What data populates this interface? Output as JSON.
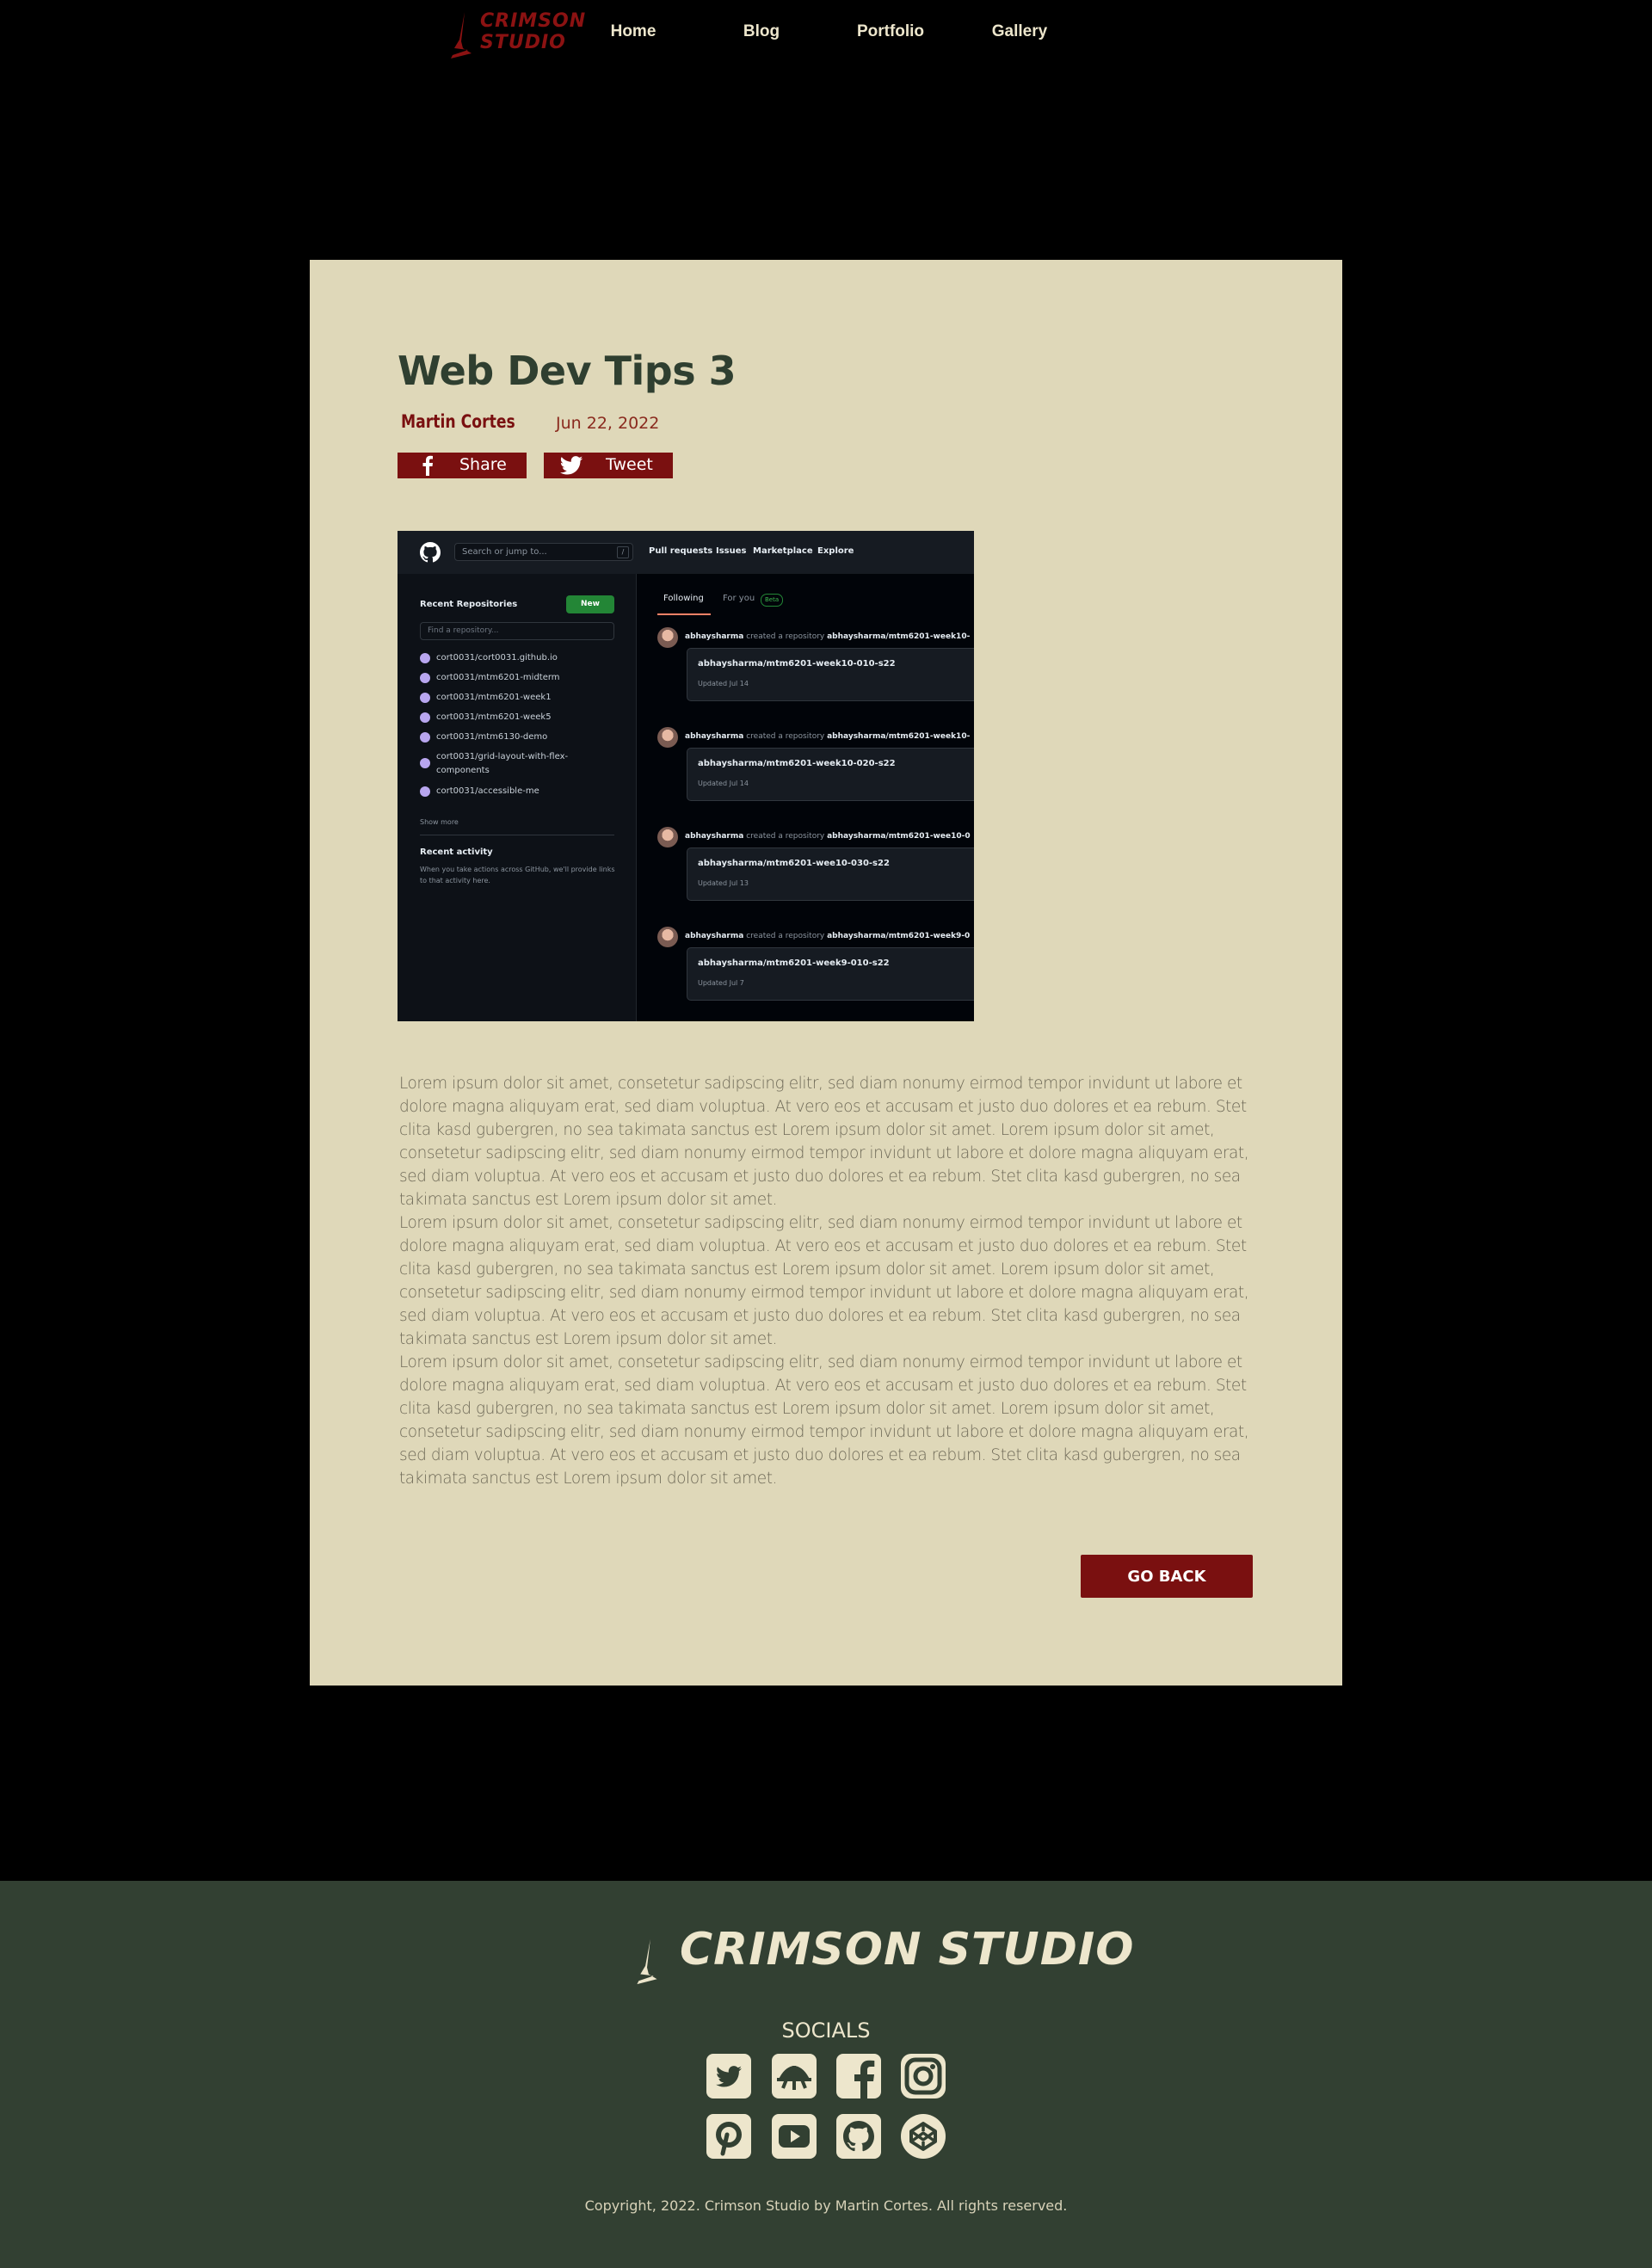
{
  "brand": {
    "header_logo_lines": [
      "CRIMSON",
      "STUDIO"
    ],
    "footer_logo_text": "CRIMSON STUDIO"
  },
  "nav": {
    "items": [
      {
        "label": "Home"
      },
      {
        "label": "Blog"
      },
      {
        "label": "Portfolio"
      },
      {
        "label": "Gallery"
      }
    ]
  },
  "post": {
    "title": "Web Dev Tips 3",
    "author": "Martin Cortes",
    "date": "Jun 22, 2022",
    "share_label": "Share",
    "tweet_label": "Tweet",
    "paragraphs": [
      "Lorem ipsum dolor sit amet, consetetur sadipscing elitr, sed diam nonumy eirmod tempor invidunt ut labore et dolore magna aliquyam erat, sed diam voluptua. At vero eos et accusam et justo duo dolores et ea rebum. Stet clita kasd gubergren, no sea takimata sanctus est Lorem ipsum dolor sit amet. Lorem ipsum dolor sit amet, consetetur sadipscing elitr, sed diam nonumy eirmod tempor invidunt ut labore et dolore magna aliquyam erat, sed diam voluptua. At vero eos et accusam et justo duo dolores et ea rebum. Stet clita kasd gubergren, no sea takimata sanctus est Lorem ipsum dolor sit amet.",
      "Lorem ipsum dolor sit amet, consetetur sadipscing elitr, sed diam nonumy eirmod tempor invidunt ut labore et dolore magna aliquyam erat, sed diam voluptua. At vero eos et accusam et justo duo dolores et ea rebum. Stet clita kasd gubergren, no sea takimata sanctus est Lorem ipsum dolor sit amet. Lorem ipsum dolor sit amet, consetetur sadipscing elitr, sed diam nonumy eirmod tempor invidunt ut labore et dolore magna aliquyam erat, sed diam voluptua. At vero eos et accusam et justo duo dolores et ea rebum. Stet clita kasd gubergren, no sea takimata sanctus est Lorem ipsum dolor sit amet.",
      "Lorem ipsum dolor sit amet, consetetur sadipscing elitr, sed diam nonumy eirmod tempor invidunt ut labore et dolore magna aliquyam erat, sed diam voluptua. At vero eos et accusam et justo duo dolores et ea rebum. Stet clita kasd gubergren, no sea takimata sanctus est Lorem ipsum dolor sit amet. Lorem ipsum dolor sit amet, consetetur sadipscing elitr, sed diam nonumy eirmod tempor invidunt ut labore et dolore magna aliquyam erat, sed diam voluptua. At vero eos et accusam et justo duo dolores et ea rebum. Stet clita kasd gubergren, no sea takimata sanctus est Lorem ipsum dolor sit amet."
    ],
    "go_back_label": "GO BACK"
  },
  "screenshot": {
    "search_placeholder": "Search or jump to...",
    "search_key": "/",
    "nav": [
      "Pull requests",
      "Issues",
      "Marketplace",
      "Explore"
    ],
    "recent_repos_heading": "Recent Repositories",
    "new_button": "New",
    "find_placeholder": "Find a repository...",
    "repos": [
      "cort0031/cort0031.github.io",
      "cort0031/mtm6201-midterm",
      "cort0031/mtm6201-week1",
      "cort0031/mtm6201-week5",
      "cort0031/mtm6130-demo",
      "cort0031/grid-layout-with-flex-components",
      "cort0031/accessible-me"
    ],
    "show_more": "Show more",
    "recent_activity_heading": "Recent activity",
    "recent_activity_text": "When you take actions across GitHub, we'll provide links to that activity here.",
    "tabs": [
      "Following",
      "For you"
    ],
    "beta_label": "Beta",
    "feed": [
      {
        "user": "abhaysharma",
        "action": "created a repository",
        "target": "abhaysharma/mtm6201-week10-",
        "repo": "abhaysharma/mtm6201-week10-010-s22",
        "updated": "Updated Jul 14"
      },
      {
        "user": "abhaysharma",
        "action": "created a repository",
        "target": "abhaysharma/mtm6201-week10-",
        "repo": "abhaysharma/mtm6201-week10-020-s22",
        "updated": "Updated Jul 14"
      },
      {
        "user": "abhaysharma",
        "action": "created a repository",
        "target": "abhaysharma/mtm6201-wee10-0",
        "repo": "abhaysharma/mtm6201-wee10-030-s22",
        "updated": "Updated Jul 13"
      },
      {
        "user": "abhaysharma",
        "action": "created a repository",
        "target": "abhaysharma/mtm6201-week9-0",
        "repo": "abhaysharma/mtm6201-week9-010-s22",
        "updated": "Updated Jul 7"
      }
    ]
  },
  "footer": {
    "socials_label": "SOCIALS",
    "socials": [
      {
        "icon": "twitter-icon"
      },
      {
        "icon": "dribbble-icon"
      },
      {
        "icon": "facebook-icon"
      },
      {
        "icon": "instagram-icon"
      },
      {
        "icon": "pinterest-icon"
      },
      {
        "icon": "youtube-icon"
      },
      {
        "icon": "github-icon"
      },
      {
        "icon": "codepen-icon"
      }
    ],
    "copyright": "Copyright, 2022. Crimson Studio by Martin Cortes. All rights reserved."
  },
  "colors": {
    "page_background": "#000000",
    "card_background": "#dfd8b9",
    "accent_crimson": "#7a1010",
    "footer_green": "#324032",
    "title_green": "#2f3f30",
    "cream": "#ede6cc"
  }
}
